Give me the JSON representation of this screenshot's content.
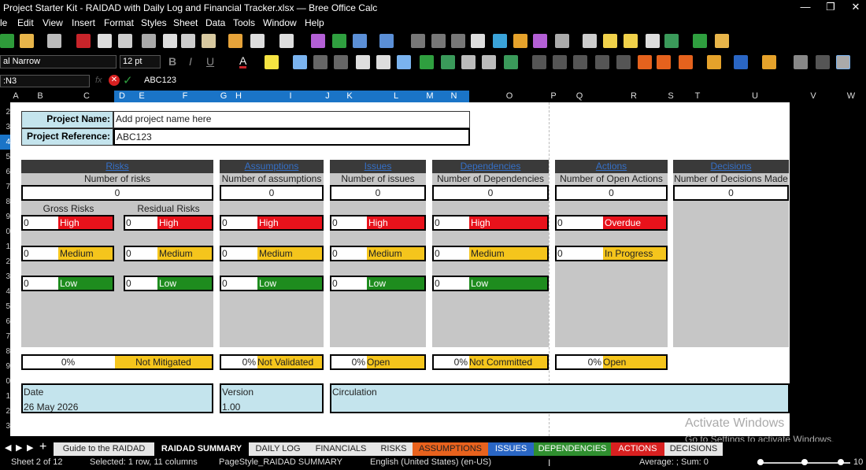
{
  "app": {
    "title": "Project Starter Kit - RAIDAD with Daily Log and Financial Tracker.xlsx — Bree Office Calc",
    "minimize": "—",
    "maximize": "❐",
    "close": "✕"
  },
  "menu": [
    "le",
    "Edit",
    "View",
    "Insert",
    "Format",
    "Styles",
    "Sheet",
    "Data",
    "Tools",
    "Window",
    "Help"
  ],
  "toolbar": {
    "font_name": "al Narrow",
    "font_size": "12 pt"
  },
  "formula_bar": {
    "name_box": ":N3",
    "content": "ABC123",
    "fx": "fx"
  },
  "columns": [
    "A",
    "B",
    "C",
    "D",
    "E",
    "F",
    "G",
    "H",
    "I",
    "J",
    "K",
    "L",
    "M",
    "N",
    "O",
    "P",
    "Q",
    "R",
    "S",
    "T",
    "U",
    "V",
    "W"
  ],
  "rows": [
    "2",
    "3",
    "4",
    "5",
    "6",
    "7",
    "8",
    "9",
    "0",
    "1",
    "2",
    "3",
    "4",
    "5",
    "6",
    "7",
    "8",
    "9",
    "0",
    "1",
    "2",
    "3"
  ],
  "project": {
    "name_label": "Project Name:",
    "name_value": "Add project name here",
    "ref_label": "Project Reference:",
    "ref_value": "ABC123"
  },
  "categories": [
    {
      "title": "Risks",
      "subtitle": "Number of risks",
      "count": "0"
    },
    {
      "title": "Assumptions",
      "subtitle": "Number of assumptions",
      "count": "0"
    },
    {
      "title": "Issues",
      "subtitle": "Number of issues",
      "count": "0"
    },
    {
      "title": "Dependencies",
      "subtitle": "Number of Dependencies",
      "count": "0"
    },
    {
      "title": "Actions",
      "subtitle": "Number of Open Actions",
      "count": "0"
    },
    {
      "title": "Decisions",
      "subtitle": "Number of Decisions Made",
      "count": "0"
    }
  ],
  "risk_headers": {
    "gross": "Gross Risks",
    "residual": "Residual Risks"
  },
  "levels": {
    "high": "High",
    "medium": "Medium",
    "low": "Low",
    "overdue": "Overdue",
    "in_progress": "In Progress",
    "zero": "0"
  },
  "status": {
    "risks": {
      "pct": "0%",
      "label": "Not Mitigated"
    },
    "assumptions": {
      "pct": "0%",
      "label": "Not Validated"
    },
    "issues": {
      "pct": "0%",
      "label": "Open"
    },
    "dependencies": {
      "pct": "0%",
      "label": "Not Committed"
    },
    "actions": {
      "pct": "0%",
      "label": "Open"
    }
  },
  "info": {
    "date_label": "Date",
    "date_value": "26 May 2026",
    "version_label": "Version",
    "version_value": "1.00",
    "circulation_label": "Circulation"
  },
  "watermark": {
    "line1": "Activate Windows",
    "line2": "Go to Settings to activate Windows."
  },
  "tabs": [
    {
      "label": "Guide to the RAIDAD",
      "bg": "#e6e6e6",
      "fg": "#222"
    },
    {
      "label": "RAIDAD SUMMARY",
      "bg": "#000000",
      "fg": "#ffffff"
    },
    {
      "label": "DAILY LOG",
      "bg": "#e6e6e6",
      "fg": "#222"
    },
    {
      "label": "FINANCIALS",
      "bg": "#e6e6e6",
      "fg": "#222"
    },
    {
      "label": "RISKS",
      "bg": "#e6e6e6",
      "fg": "#222"
    },
    {
      "label": "ASSUMPTIONS",
      "bg": "#e8621d",
      "fg": "#222"
    },
    {
      "label": "ISSUES",
      "bg": "#2a66c4",
      "fg": "#fff"
    },
    {
      "label": "DEPENDENCIES",
      "bg": "#2f8f2f",
      "fg": "#fff"
    },
    {
      "label": "ACTIONS",
      "bg": "#d82020",
      "fg": "#fff"
    },
    {
      "label": "DECISIONS",
      "bg": "#e6e6e6",
      "fg": "#222"
    }
  ],
  "statusbar": {
    "sheet": "Sheet 2 of 12",
    "selection": "Selected: 1 row, 11 columns",
    "pagestyle": "PageStyle_RAIDAD SUMMARY",
    "language": "English (United States) (en-US)",
    "sum": "Average: ; Sum: 0",
    "zoom": "10"
  }
}
